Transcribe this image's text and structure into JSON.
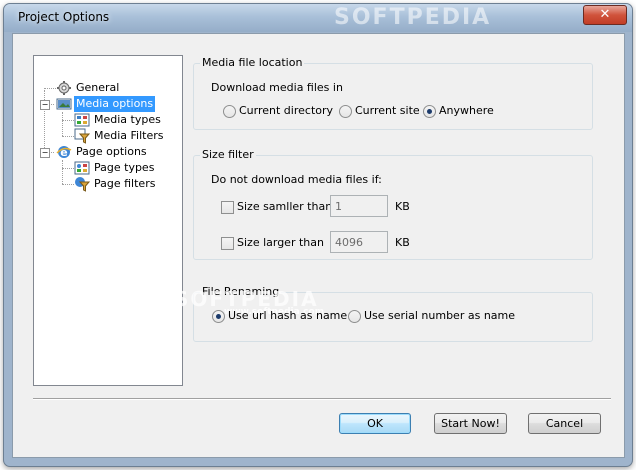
{
  "window": {
    "title": "Project Options",
    "close_glyph": "✕"
  },
  "tree": {
    "items": [
      {
        "label": "General",
        "icon": "gear-icon"
      },
      {
        "label": "Media options",
        "icon": "media-icon",
        "selected": true
      },
      {
        "label": "Media types",
        "icon": "media-types-icon"
      },
      {
        "label": "Media Filters",
        "icon": "filter-icon"
      },
      {
        "label": "Page options",
        "icon": "page-icon"
      },
      {
        "label": "Page types",
        "icon": "page-types-icon"
      },
      {
        "label": "Page filters",
        "icon": "filter-icon"
      }
    ]
  },
  "media_location": {
    "title": "Media file location",
    "prompt": "Download media files in",
    "options": [
      {
        "label": "Current directory",
        "checked": false
      },
      {
        "label": "Current site",
        "checked": false
      },
      {
        "label": "Anywhere",
        "checked": true
      }
    ]
  },
  "size_filter": {
    "title": "Size filter",
    "prompt": "Do not download media files if:",
    "smaller_label": "Size samller than",
    "smaller_value": "1",
    "larger_label": "Size larger than",
    "larger_value": "4096",
    "unit": "KB"
  },
  "file_renaming": {
    "title": "File Renaming",
    "options": [
      {
        "label": "Use url hash as name",
        "checked": true
      },
      {
        "label": "Use serial number as name",
        "checked": false
      }
    ]
  },
  "buttons": {
    "ok": "OK",
    "start_now": "Start Now!",
    "cancel": "Cancel"
  },
  "watermark": {
    "top": "SOFTPEDIA",
    "middle": "SOFTPEDIA",
    "url": "www.softpedia.com"
  },
  "colors": {
    "selection": "#3399ff",
    "title_bar": "#a9c0d9",
    "close_button": "#c23d26"
  }
}
